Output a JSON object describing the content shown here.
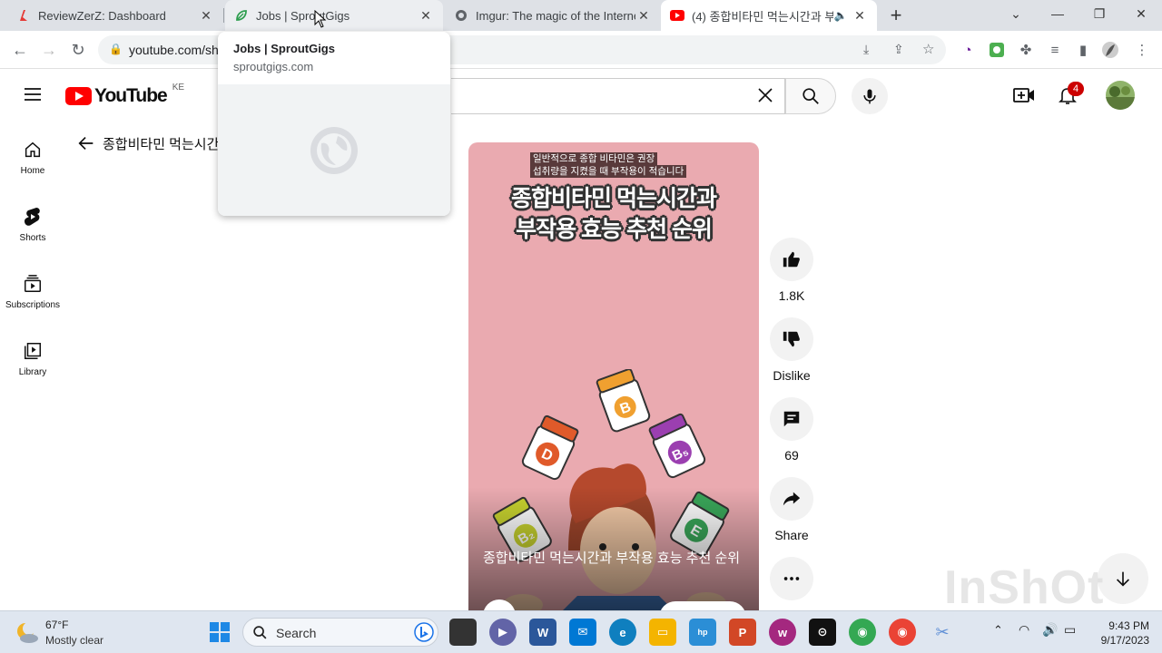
{
  "browser": {
    "tabs": [
      {
        "title": "ReviewZerZ: Dashboard",
        "icon": "reviewzerz-icon"
      },
      {
        "title": "Jobs | SproutGigs",
        "icon": "sproutgigs-icon"
      },
      {
        "title": "Imgur: The magic of the Internet",
        "icon": "imgur-icon"
      },
      {
        "title": "(4) 종합비타민 먹는시간과 부",
        "icon": "youtube-icon"
      }
    ],
    "url": "youtube.com/sh",
    "hover_card": {
      "title": "Jobs | SproutGigs",
      "domain": "sproutgigs.com"
    }
  },
  "youtube": {
    "country_code": "KE",
    "logo_text": "YouTube",
    "notification_count": "4",
    "sidebar": [
      {
        "label": "Home",
        "icon": "home-icon"
      },
      {
        "label": "Shorts",
        "icon": "shorts-icon"
      },
      {
        "label": "Subscriptions",
        "icon": "subscriptions-icon"
      },
      {
        "label": "Library",
        "icon": "library-icon"
      }
    ],
    "back_title": "종합비타민 먹는시간",
    "video": {
      "caption_line1": "일반적으로 종합 비타민은 권장",
      "caption_line2": "섭취량을 지켰을 때 부작용이 적습니다",
      "overlay_title_line1": "종합비타민 먹는시간과",
      "overlay_title_line2": "부작용 효능 추천 순위",
      "title": "종합비타민 먹는시간과 부작용 효능 추천 순위",
      "bottle_labels": [
        "D",
        "B",
        "B₅",
        "B₂",
        "E"
      ]
    },
    "actions": [
      {
        "label": "1.8K",
        "icon": "thumbs-up-icon"
      },
      {
        "label": "Dislike",
        "icon": "thumbs-down-icon"
      },
      {
        "label": "69",
        "icon": "comment-icon"
      },
      {
        "label": "Share",
        "icon": "share-icon"
      }
    ],
    "watermark": "InShOt"
  },
  "taskbar": {
    "weather_temp": "67°F",
    "weather_cond": "Mostly clear",
    "search_label": "Search",
    "time": "9:43 PM",
    "date": "9/17/2023"
  },
  "colors": {
    "youtube_red": "#ff0000",
    "video_bg": "#eaaab0",
    "tabstrip": "#dee1e6",
    "taskbar": "#dfe6f0"
  }
}
